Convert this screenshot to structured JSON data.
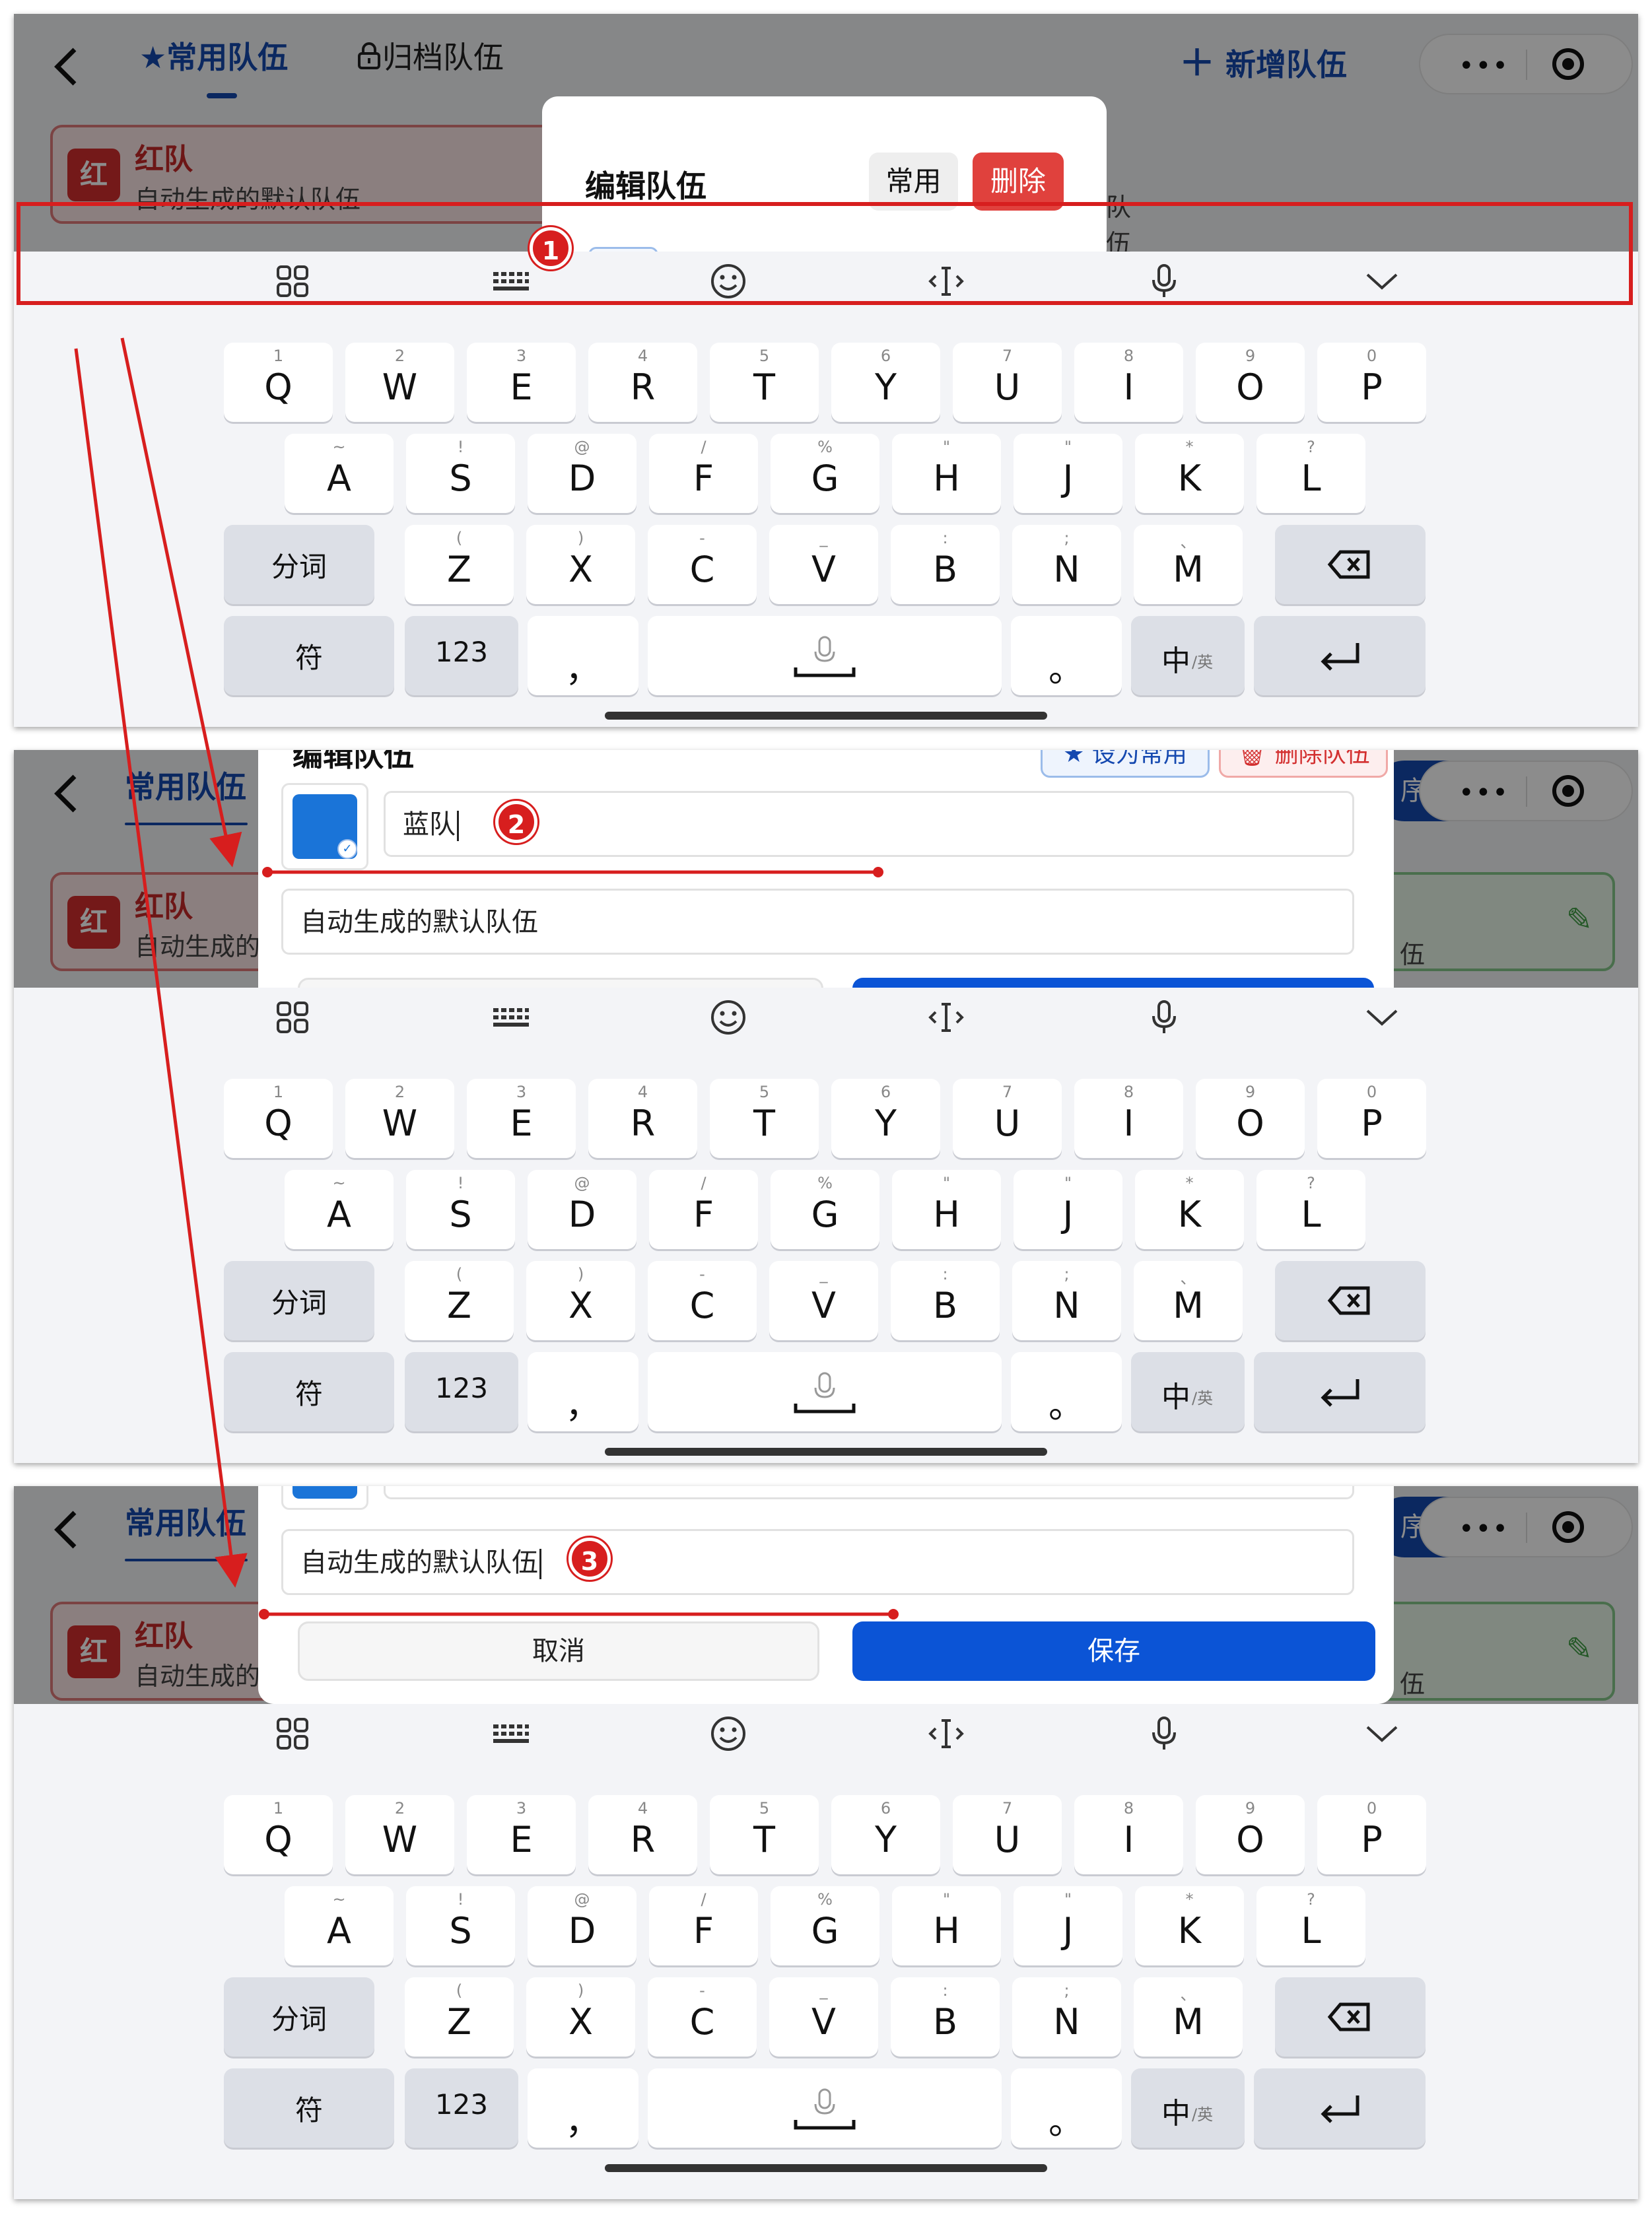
{
  "nav": {
    "tab_common": "常用队伍",
    "tab_archived": "归档队伍",
    "add_team": "新增队伍",
    "sort_fragment": "序"
  },
  "teams": [
    {
      "badge": "红",
      "name": "红队",
      "description": "自动生成的默认队伍",
      "description_clipped": "自动生成的"
    },
    {
      "description_tail": "队伍"
    },
    {
      "description_tail": "伍"
    }
  ],
  "dialog": {
    "title": "编辑队伍",
    "common_button": "常用",
    "delete_button": "删除",
    "set_common_button": "设为常用",
    "delete_team_button": "删除队伍",
    "name_value": "蓝队",
    "description_value": "自动生成的默认队伍",
    "cancel_button": "取消",
    "save_button": "保存",
    "selected_color": "#1a74d8"
  },
  "keyboard": {
    "row1": [
      {
        "k": "Q",
        "s": "1"
      },
      {
        "k": "W",
        "s": "2"
      },
      {
        "k": "E",
        "s": "3"
      },
      {
        "k": "R",
        "s": "4"
      },
      {
        "k": "T",
        "s": "5"
      },
      {
        "k": "Y",
        "s": "6"
      },
      {
        "k": "U",
        "s": "7"
      },
      {
        "k": "I",
        "s": "8"
      },
      {
        "k": "O",
        "s": "9"
      },
      {
        "k": "P",
        "s": "0"
      }
    ],
    "row2": [
      {
        "k": "A",
        "s": "~"
      },
      {
        "k": "S",
        "s": "!"
      },
      {
        "k": "D",
        "s": "@"
      },
      {
        "k": "F",
        "s": "/"
      },
      {
        "k": "G",
        "s": "%"
      },
      {
        "k": "H",
        "s": "\""
      },
      {
        "k": "J",
        "s": "\""
      },
      {
        "k": "K",
        "s": "*"
      },
      {
        "k": "L",
        "s": "?"
      }
    ],
    "row3": [
      {
        "k": "Z",
        "s": "("
      },
      {
        "k": "X",
        "s": ")"
      },
      {
        "k": "C",
        "s": "-"
      },
      {
        "k": "V",
        "s": "_"
      },
      {
        "k": "B",
        "s": ":"
      },
      {
        "k": "N",
        "s": ";"
      },
      {
        "k": "M",
        "s": "、"
      }
    ],
    "segment_key": "分词",
    "symbol_key": "符",
    "number_key": "123",
    "comma_key": "，",
    "period_key": "。",
    "lang_key_main": "中",
    "lang_key_sub": "/英"
  },
  "annotations": [
    "1",
    "2",
    "3"
  ],
  "colors": {
    "accent": "#1549b0",
    "danger": "#e0413d",
    "annotation_red": "#d71e1e",
    "save_blue": "#0b54d6"
  }
}
